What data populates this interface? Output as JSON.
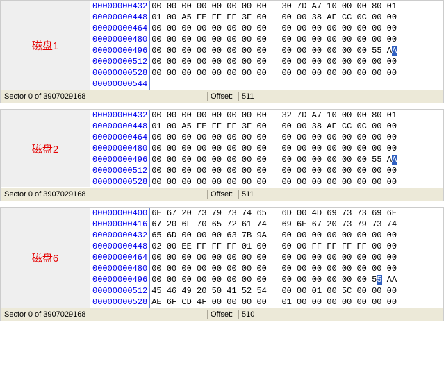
{
  "panels": [
    {
      "label": "磁盘1",
      "offsets": [
        "00000000432",
        "00000000448",
        "00000000464",
        "00000000480",
        "00000000496",
        "00000000512",
        "00000000528",
        "00000000544"
      ],
      "bytes": [
        "00 00 00 00 00 00 00 00   30 7D A7 10 00 00 80 01",
        "01 00 A5 FE FF FF 3F 00   00 00 38 AF CC 0C 00 00",
        "00 00 00 00 00 00 00 00   00 00 00 00 00 00 00 00",
        "00 00 00 00 00 00 00 00   00 00 00 00 00 00 00 00",
        "00 00 00 00 00 00 00 00   00 00 00 00 00 00 55 AA",
        "00 00 00 00 00 00 00 00   00 00 00 00 00 00 00 00",
        "00 00 00 00 00 00 00 00   00 00 00 00 00 00 00 00",
        ""
      ],
      "sel_row": 4,
      "sel_start": 15,
      "status_sector": "Sector 0 of 3907029168",
      "status_offset_label": "Offset:",
      "status_offset_value": "511"
    },
    {
      "label": "磁盘2",
      "offsets": [
        "00000000432",
        "00000000448",
        "00000000464",
        "00000000480",
        "00000000496",
        "00000000512",
        "00000000528"
      ],
      "bytes": [
        "00 00 00 00 00 00 00 00   32 7D A7 10 00 00 80 01",
        "01 00 A5 FE FF FF 3F 00   00 00 38 AF CC 0C 00 00",
        "00 00 00 00 00 00 00 00   00 00 00 00 00 00 00 00",
        "00 00 00 00 00 00 00 00   00 00 00 00 00 00 00 00",
        "00 00 00 00 00 00 00 00   00 00 00 00 00 00 55 AA",
        "00 00 00 00 00 00 00 00   00 00 00 00 00 00 00 00",
        "00 00 00 00 00 00 00 00   00 00 00 00 00 00 00 00"
      ],
      "sel_row": 4,
      "sel_start": 15,
      "status_sector": "Sector 0 of 3907029168",
      "status_offset_label": "Offset:",
      "status_offset_value": "511"
    },
    {
      "label": "磁盘6",
      "offsets": [
        "00000000400",
        "00000000416",
        "00000000432",
        "00000000448",
        "00000000464",
        "00000000480",
        "00000000496",
        "00000000512",
        "00000000528"
      ],
      "bytes": [
        "6E 67 20 73 79 73 74 65   6D 00 4D 69 73 73 69 6E",
        "67 20 6F 70 65 72 61 74   69 6E 67 20 73 79 73 74",
        "65 6D 00 00 00 63 7B 9A   00 00 00 00 00 00 00 00",
        "02 00 EE FF FF FF 01 00   00 00 FF FF FF FF 00 00",
        "00 00 00 00 00 00 00 00   00 00 00 00 00 00 00 00",
        "00 00 00 00 00 00 00 00   00 00 00 00 00 00 00 00",
        "00 00 00 00 00 00 00 00   00 00 00 00 00 00 55 AA",
        "45 46 49 20 50 41 52 54   00 00 01 00 5C 00 00 00",
        "AE 6F CD 4F 00 00 00 00   01 00 00 00 00 00 00 00"
      ],
      "sel_row": 6,
      "sel_start": 14,
      "status_sector": "Sector 0 of 3907029168",
      "status_offset_label": "Offset:",
      "status_offset_value": "510"
    }
  ]
}
